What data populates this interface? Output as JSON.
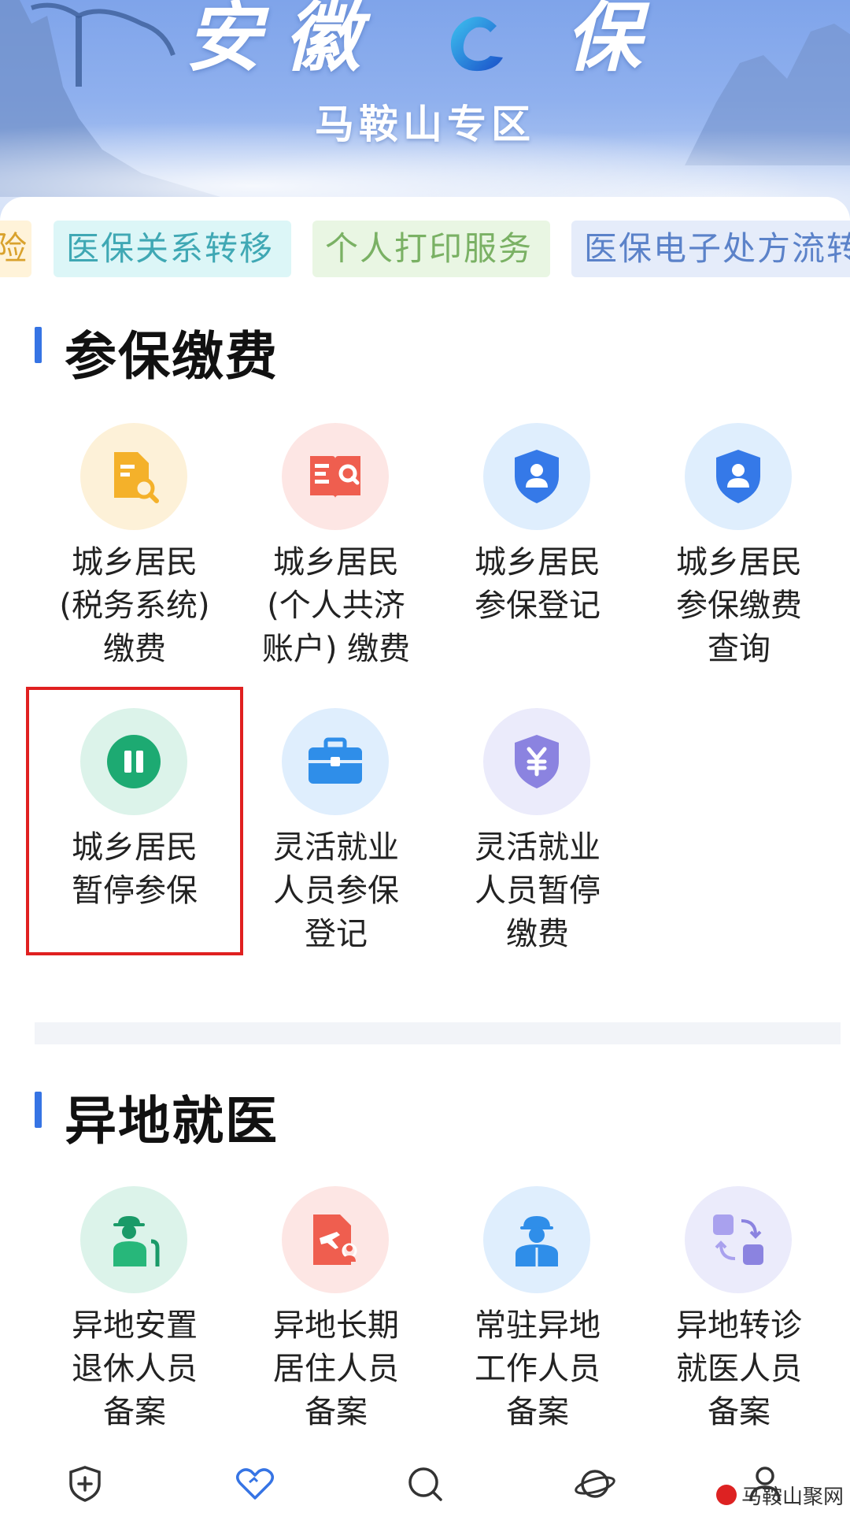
{
  "banner": {
    "brand_left": "安徽",
    "brand_right": "保",
    "zone_title": "马鞍山专区"
  },
  "chips": [
    {
      "label": "险",
      "color": "#d9a22d"
    },
    {
      "label": "医保关系转移",
      "color": "#3fa8b4"
    },
    {
      "label": "个人打印服务",
      "color": "#7ab164"
    },
    {
      "label": "医保电子处方流转",
      "color": "#5b82c9"
    }
  ],
  "section_payment": {
    "title": "参保缴费",
    "items": [
      {
        "icon": "document-search-icon",
        "lines": [
          "城乡居民",
          "(税务系统)",
          "缴费"
        ]
      },
      {
        "icon": "book-search-icon",
        "lines": [
          "城乡居民",
          "(个人共济",
          "账户) 缴费"
        ]
      },
      {
        "icon": "shield-user-icon",
        "lines": [
          "城乡居民",
          "参保登记"
        ]
      },
      {
        "icon": "shield-user-icon",
        "lines": [
          "城乡居民",
          "参保缴费",
          "查询"
        ]
      },
      {
        "icon": "pause-icon",
        "lines": [
          "城乡居民",
          "暂停参保"
        ]
      },
      {
        "icon": "briefcase-icon",
        "lines": [
          "灵活就业",
          "人员参保",
          "登记"
        ]
      },
      {
        "icon": "shield-yen-icon",
        "lines": [
          "灵活就业",
          "人员暂停",
          "缴费"
        ]
      }
    ]
  },
  "section_remote": {
    "title": "异地就医",
    "items": [
      {
        "icon": "retiree-icon",
        "lines": [
          "异地安置",
          "退休人员",
          "备案"
        ]
      },
      {
        "icon": "travel-document-icon",
        "lines": [
          "异地长期",
          "居住人员",
          "备案"
        ]
      },
      {
        "icon": "worker-icon",
        "lines": [
          "常驻异地",
          "工作人员",
          "备案"
        ]
      },
      {
        "icon": "transfer-icon",
        "lines": [
          "异地转诊",
          "就医人员",
          "备案"
        ]
      }
    ]
  },
  "bottom_nav": {
    "items": [
      {
        "icon": "shield-plus-icon",
        "active": false
      },
      {
        "icon": "heart-icon",
        "active": true
      },
      {
        "icon": "search-icon",
        "active": false
      },
      {
        "icon": "planet-icon",
        "active": false
      },
      {
        "icon": "user-icon",
        "active": false
      }
    ]
  },
  "watermark": {
    "text": "马鞍山聚网"
  },
  "colors": {
    "accent": "#3674e4",
    "highlight": "#e02020"
  }
}
